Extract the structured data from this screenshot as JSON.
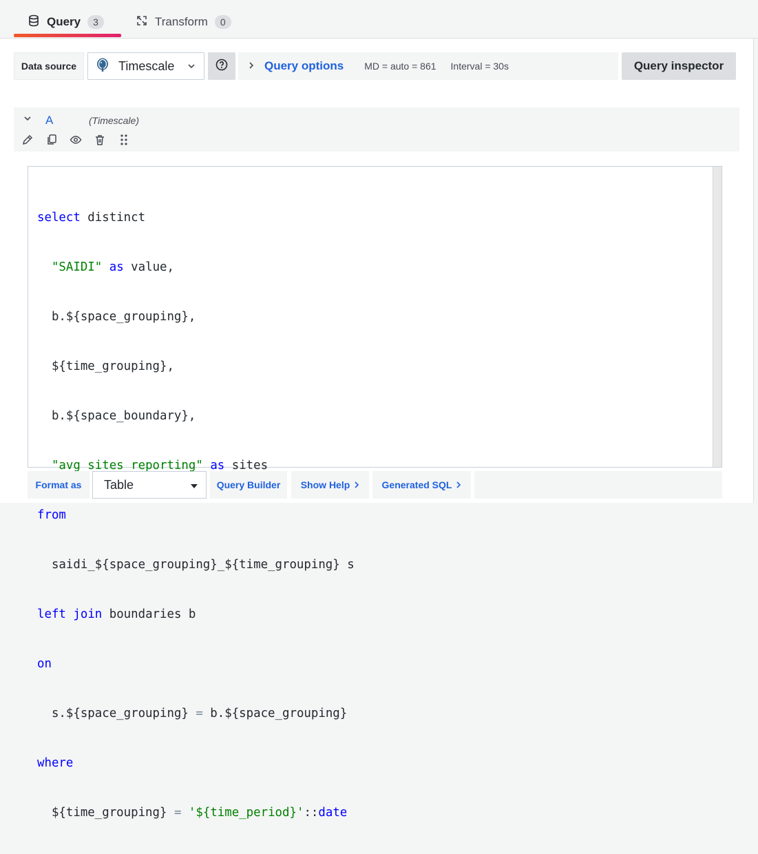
{
  "tabs": [
    {
      "label": "Query",
      "count": "3",
      "icon": "database-icon"
    },
    {
      "label": "Transform",
      "count": "0",
      "icon": "transform-icon"
    }
  ],
  "toolbar": {
    "data_source_label": "Data source",
    "data_source_value": "Timescale",
    "query_options_label": "Query options",
    "md": "MD = auto = 861",
    "interval": "Interval = 30s",
    "query_inspector_label": "Query inspector"
  },
  "query": {
    "ref_id": "A",
    "datasource": "(Timescale)"
  },
  "code_lines": [
    "select distinct",
    "  \"SAIDI\" as value,",
    "  b.${space_grouping},",
    "  ${time_grouping},",
    "  b.${space_boundary},",
    "  \"avg_sites_reporting\" as sites",
    "from",
    "  saidi_${space_grouping}_${time_grouping} s",
    "left join boundaries b",
    "on",
    "  s.${space_grouping} = b.${space_grouping}",
    "where",
    "  ${time_grouping} = '${time_period}'::date"
  ],
  "bottom": {
    "format_as_label": "Format as",
    "format_value": "Table",
    "query_builder_label": "Query Builder",
    "show_help_label": "Show Help",
    "generated_sql_label": "Generated SQL"
  },
  "colors": {
    "accent": "#1f62e0",
    "keyword": "#0000ff",
    "string": "#008000"
  }
}
